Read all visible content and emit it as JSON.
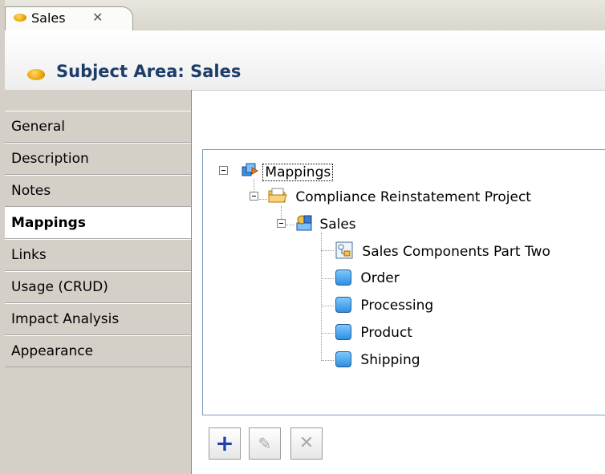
{
  "tab": {
    "label": "Sales",
    "close": "✕"
  },
  "title": "Subject Area: Sales",
  "nav": {
    "items": [
      {
        "label": "General"
      },
      {
        "label": "Description"
      },
      {
        "label": "Notes"
      },
      {
        "label": "Mappings",
        "active": true
      },
      {
        "label": "Links"
      },
      {
        "label": "Usage (CRUD)"
      },
      {
        "label": "Impact Analysis"
      },
      {
        "label": "Appearance"
      }
    ]
  },
  "tree": {
    "root": "Mappings",
    "project": "Compliance Reinstatement  Project",
    "model": "Sales",
    "children": [
      "Sales Components Part Two",
      "Order",
      "Processing",
      "Product",
      "Shipping"
    ]
  },
  "toolbar": {
    "add": "+",
    "edit": "✎",
    "delete": "✕"
  },
  "colors": {
    "title": "#1c3c6a",
    "accent_orange": "#e89a00",
    "entity_blue": "#2f8fe0",
    "add_button": "#1f3fa8"
  },
  "icons": [
    "oval-subject-area-icon",
    "mappings-icon",
    "folder-project-icon",
    "model-icon",
    "diagram-icon",
    "entity-icon",
    "add-icon",
    "edit-icon",
    "delete-icon"
  ]
}
